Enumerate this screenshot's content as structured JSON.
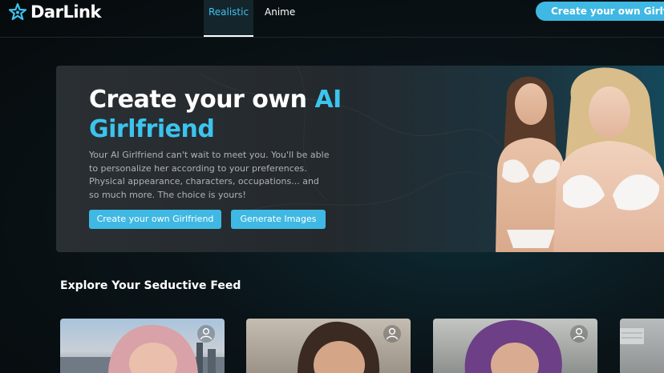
{
  "header": {
    "brand": "DarLink",
    "tabs": [
      {
        "label": "Realistic",
        "active": true
      },
      {
        "label": "Anime",
        "active": false
      }
    ],
    "cta_label": "Create your own Girlfriend"
  },
  "hero": {
    "title_prefix": "Create your own ",
    "title_accent": "AI Girlfriend",
    "description": "Your AI Girlfriend can't wait to meet you. You'll be able to personalize her according to your preferences. Physical appearance, characters, occupations... and so much more. The choice is yours!",
    "create_button": "Create your own Girlfriend",
    "generate_button": "Generate Images"
  },
  "feed": {
    "title": "Explore Your Seductive Feed",
    "cards": [
      {
        "icon": "user-icon"
      },
      {
        "icon": "user-icon"
      },
      {
        "icon": "user-icon"
      },
      {
        "icon": "none"
      }
    ]
  },
  "colors": {
    "accent": "#3cc3ee",
    "button": "#3fb8e3",
    "background": "#0a1418"
  }
}
